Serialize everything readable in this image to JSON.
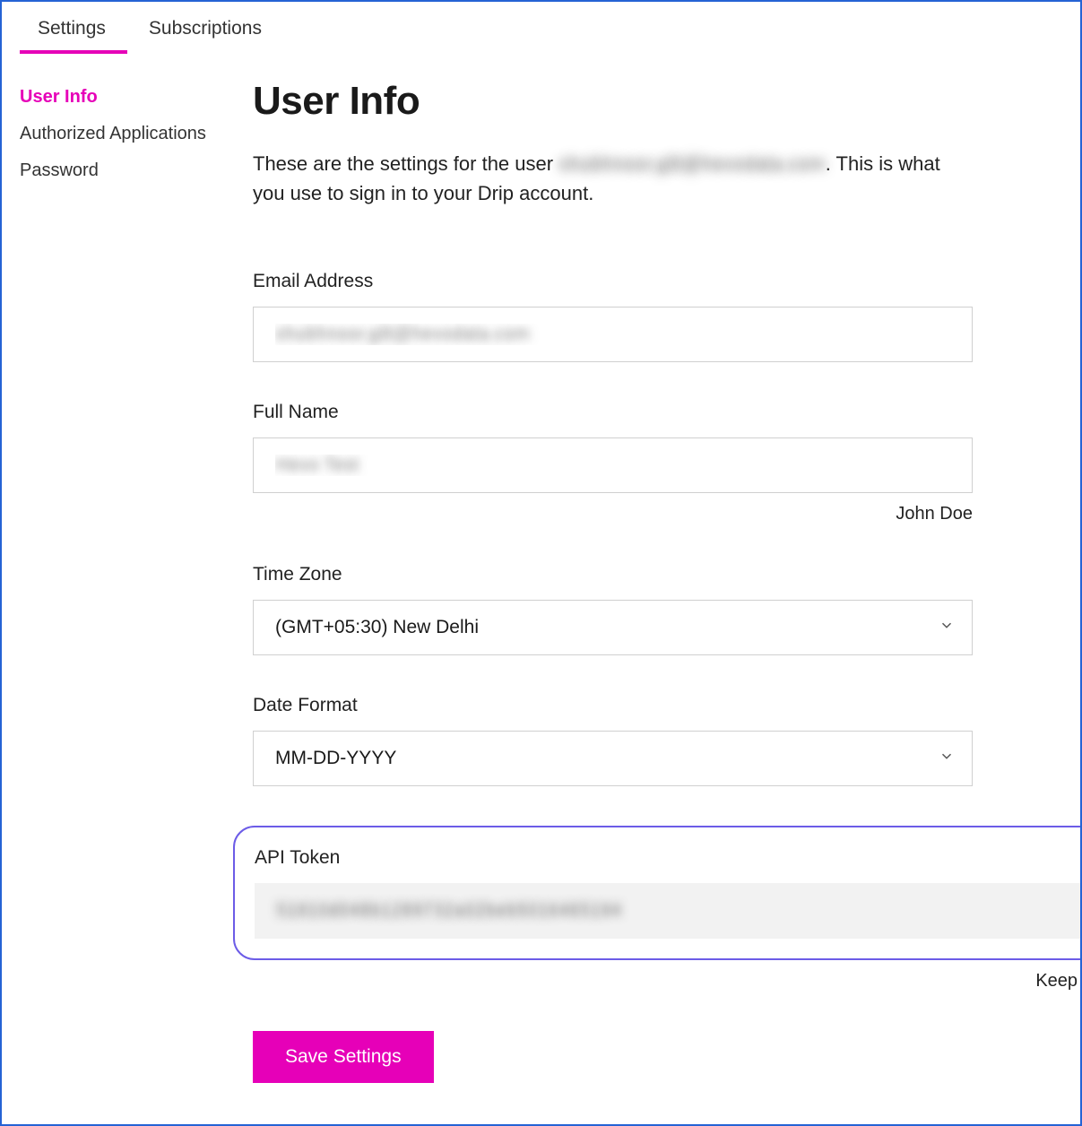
{
  "tabs": {
    "settings": "Settings",
    "subscriptions": "Subscriptions"
  },
  "sidebar": {
    "user_info": "User Info",
    "authorized_apps": "Authorized Applications",
    "password": "Password"
  },
  "page": {
    "title": "User Info",
    "desc_prefix": "These are the settings for the user ",
    "desc_email_masked": "shubhnoor.gilt@hevodata.com",
    "desc_suffix": ". This is what you use to sign in to your Drip account."
  },
  "fields": {
    "email_label": "Email Address",
    "email_value_masked": "shubhnoor.gilt@hevodata.com",
    "fullname_label": "Full Name",
    "fullname_value_masked": "Hevo Test",
    "fullname_hint": "John Doe",
    "timezone_label": "Time Zone",
    "timezone_value": "(GMT+05:30) New Delhi",
    "dateformat_label": "Date Format",
    "dateformat_value": "MM-DD-YYYY",
    "apitoken_label": "API Token",
    "apitoken_value_masked": "51810d048b1289732a02beb5016465194",
    "apitoken_hint": "Keep this a secret!"
  },
  "actions": {
    "save": "Save Settings"
  }
}
